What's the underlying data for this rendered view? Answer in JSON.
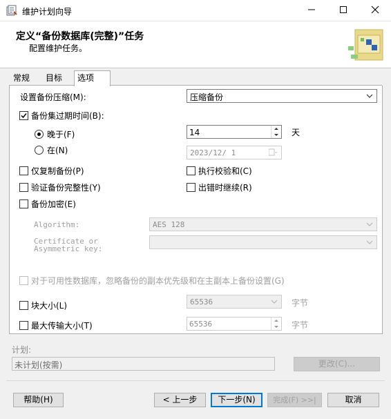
{
  "window": {
    "title": "维护计划向导",
    "minimize": "—",
    "maximize": "☐",
    "close": "✕"
  },
  "header": {
    "title": "定义“备份数据库(完整)”任务",
    "subtitle": "配置维护任务。"
  },
  "tabs": [
    {
      "label": "常规"
    },
    {
      "label": "目标"
    },
    {
      "label": "选项"
    }
  ],
  "options": {
    "compression_label": "设置备份压缩(M):",
    "compression_value": "压缩备份",
    "expire_label": "备份集过期时间(B):",
    "expire_checked": true,
    "after_label": "晚于(F)",
    "after_value": "14",
    "after_unit": "天",
    "on_label": "在(N)",
    "on_date": "2023/12/  1",
    "copy_only_label": "仅复制备份(P)",
    "checksum_label": "执行校验和(C)",
    "verify_label": "验证备份完整性(Y)",
    "continue_on_error_label": "出错时继续(R)",
    "encrypt_label": "备份加密(E)",
    "algorithm_label": "Algorithm:",
    "algorithm_value": "AES 128",
    "cert_label": "Certificate or Asymmetric key:",
    "cert_value": "",
    "ag_label": "对于可用性数据库，忽略备份的副本优先级和在主副本上备份设置(G)",
    "block_size_label": "块大小(L)",
    "block_size_value": "65536",
    "block_size_unit": "字节",
    "max_transfer_label": "最大传输大小(T)",
    "max_transfer_value": "65536",
    "max_transfer_unit": "字节"
  },
  "schedule": {
    "label": "计划:",
    "value": "未计划(按需)",
    "change_button": "更改(C)..."
  },
  "footer": {
    "help": "帮助(H)",
    "back": "< 上一步",
    "next": "下一步(N)",
    "finish": "完成(F) >>|",
    "cancel": "取消"
  },
  "colors": {
    "accent": "#0078d7",
    "panel_bg": "#ffffff",
    "dialog_bg": "#f0f0f0"
  }
}
